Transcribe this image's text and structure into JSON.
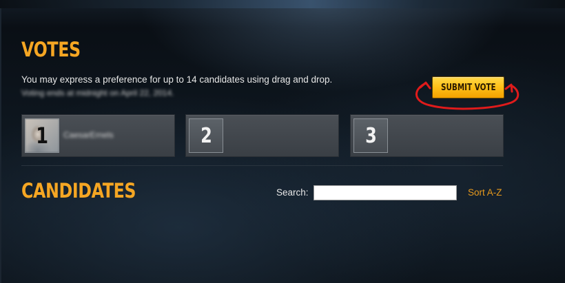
{
  "votes": {
    "title": "VOTES",
    "instructions": "You may express a preference for up to 14 candidates using drag and drop.",
    "blurred_note": "Voting ends at midnight on April 22, 2014.",
    "submit_label": "SUBMIT VOTE",
    "slots": [
      {
        "number": "1",
        "name": "CaesarErnels",
        "has_avatar": true
      },
      {
        "number": "2",
        "name": "",
        "has_avatar": false
      },
      {
        "number": "3",
        "name": "",
        "has_avatar": false
      }
    ]
  },
  "candidates": {
    "title": "CANDIDATES",
    "search_label": "Search:",
    "search_value": "",
    "sort_label": "Sort A-Z"
  },
  "colors": {
    "accent": "#f5a623",
    "button": "#ffc21a",
    "annotation": "#e01b1b",
    "link": "#e89a1c"
  },
  "icons": {
    "avatar": "user-avatar"
  }
}
